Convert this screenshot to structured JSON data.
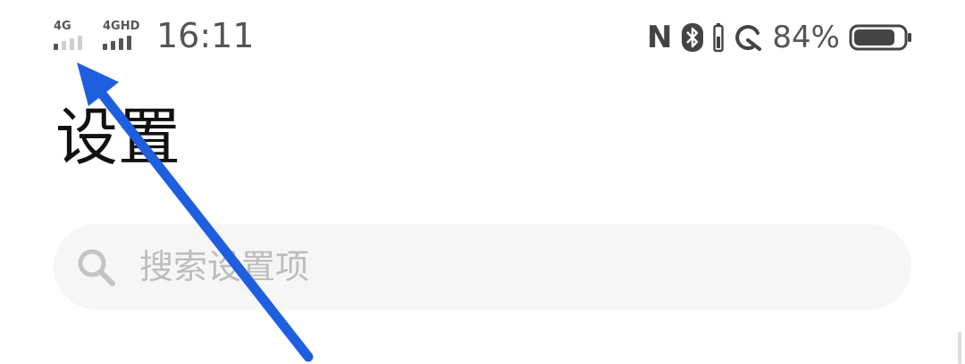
{
  "status_bar": {
    "sim1": {
      "network_type": "4G",
      "signal_level": 1,
      "signal_max": 4
    },
    "sim2": {
      "network_type": "4GHD",
      "signal_level": 4,
      "signal_max": 4
    },
    "time": "16:11",
    "icons": [
      "nfc-icon",
      "bluetooth-icon",
      "battery-saver-icon",
      "battery-icon"
    ],
    "battery_percent": "84%",
    "battery_level": 0.84
  },
  "page": {
    "title": "设置"
  },
  "search": {
    "placeholder": "搜索设置项"
  },
  "colors": {
    "background": "#ffffff",
    "search_bg": "#f6f6f6",
    "placeholder": "#bdbdbd",
    "status_text": "#555555",
    "arrow": "#1e5fe0"
  }
}
